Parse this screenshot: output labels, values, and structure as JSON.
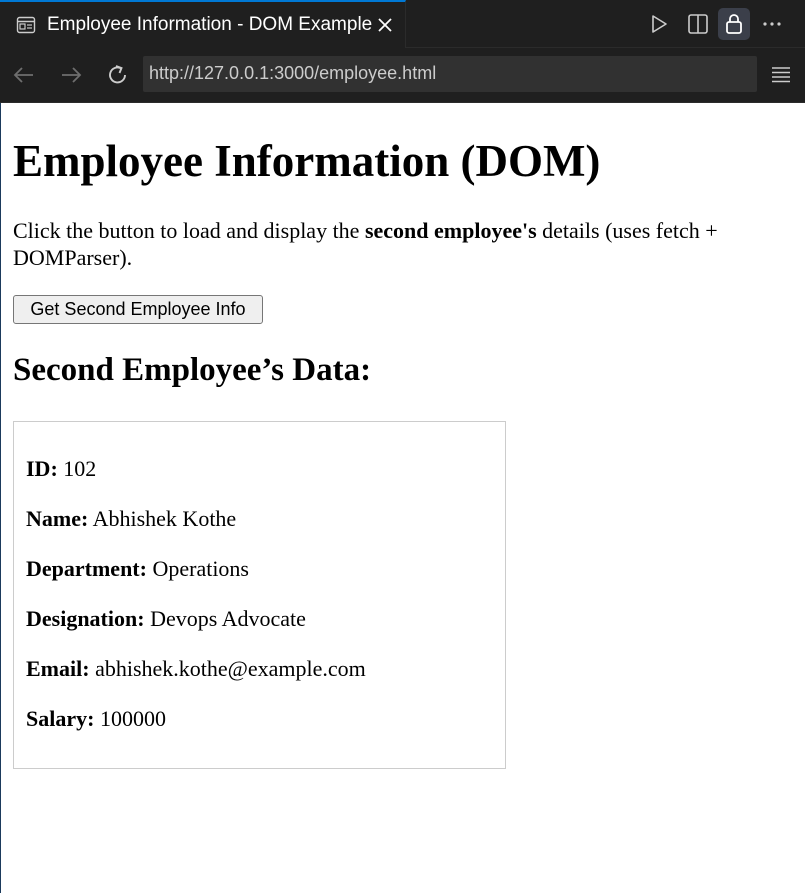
{
  "tab": {
    "title": "Employee Information - DOM Example",
    "icon": "browser-preview-icon"
  },
  "navigation": {
    "url": "http://127.0.0.1:3000/employee.html"
  },
  "page": {
    "heading": "Employee Information (DOM)",
    "intro_prefix": "Click the button to load and display the ",
    "intro_bold": "second employee's",
    "intro_suffix": " details (uses fetch + DOMParser).",
    "button_label": "Get Second Employee Info",
    "subheading": "Second Employee’s Data:"
  },
  "employee": {
    "id": {
      "label": "ID:",
      "value": "102"
    },
    "name": {
      "label": "Name:",
      "value": "Abhishek Kothe"
    },
    "department": {
      "label": "Department:",
      "value": "Operations"
    },
    "designation": {
      "label": "Designation:",
      "value": "Devops Advocate"
    },
    "email": {
      "label": "Email:",
      "value": "abhishek.kothe@example.com"
    },
    "salary": {
      "label": "Salary:",
      "value": "100000"
    }
  },
  "colors": {
    "chrome_bg": "#1f1f1f",
    "url_bg": "#313131",
    "accent": "#0078d4",
    "page_bg": "#ffffff"
  }
}
